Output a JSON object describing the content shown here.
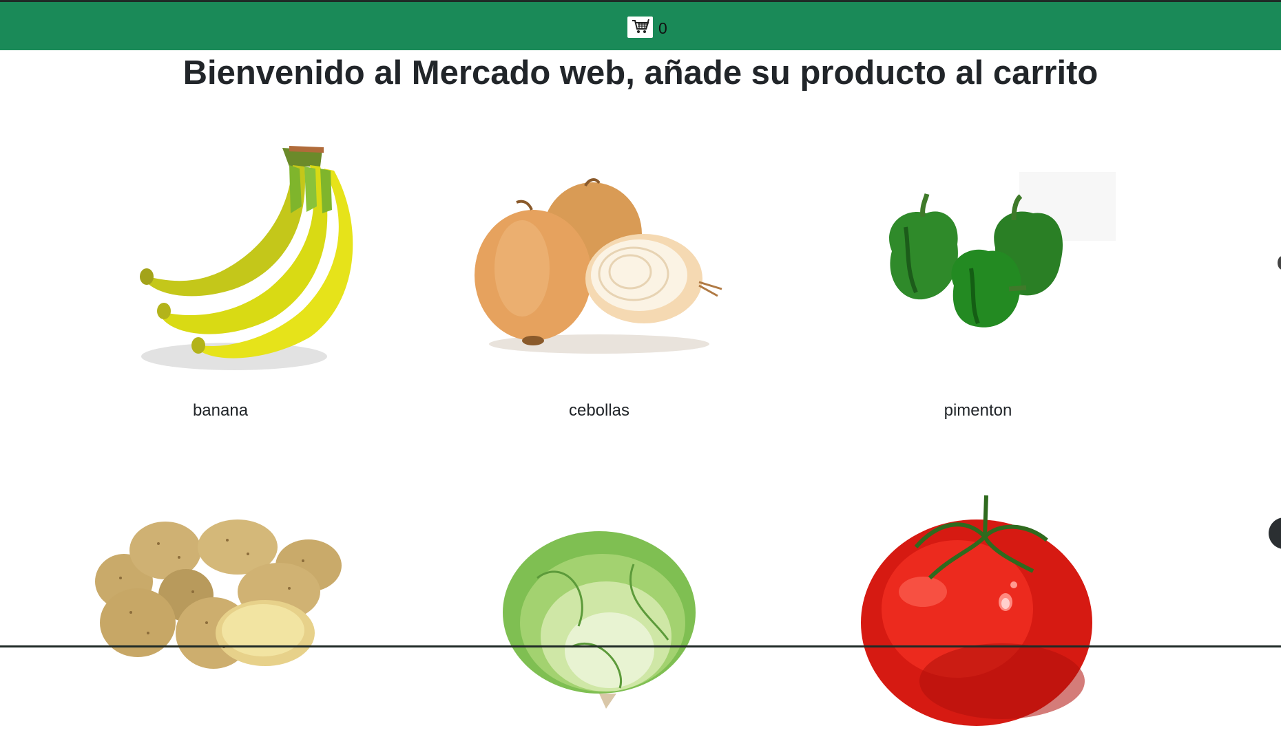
{
  "navbar": {
    "cart_icon": "shopping-cart-icon",
    "cart_count": "0",
    "brand_color": "#1a8a58"
  },
  "page": {
    "title": "Bienvenido al Mercado web, añade su producto al carrito"
  },
  "products": [
    {
      "name": "banana",
      "image": "banana-image"
    },
    {
      "name": "cebollas",
      "image": "onions-image"
    },
    {
      "name": "pimenton",
      "image": "green-peppers-image"
    },
    {
      "name": "",
      "image": "potatoes-image"
    },
    {
      "name": "",
      "image": "lettuce-image"
    },
    {
      "name": "",
      "image": "tomato-image"
    }
  ]
}
